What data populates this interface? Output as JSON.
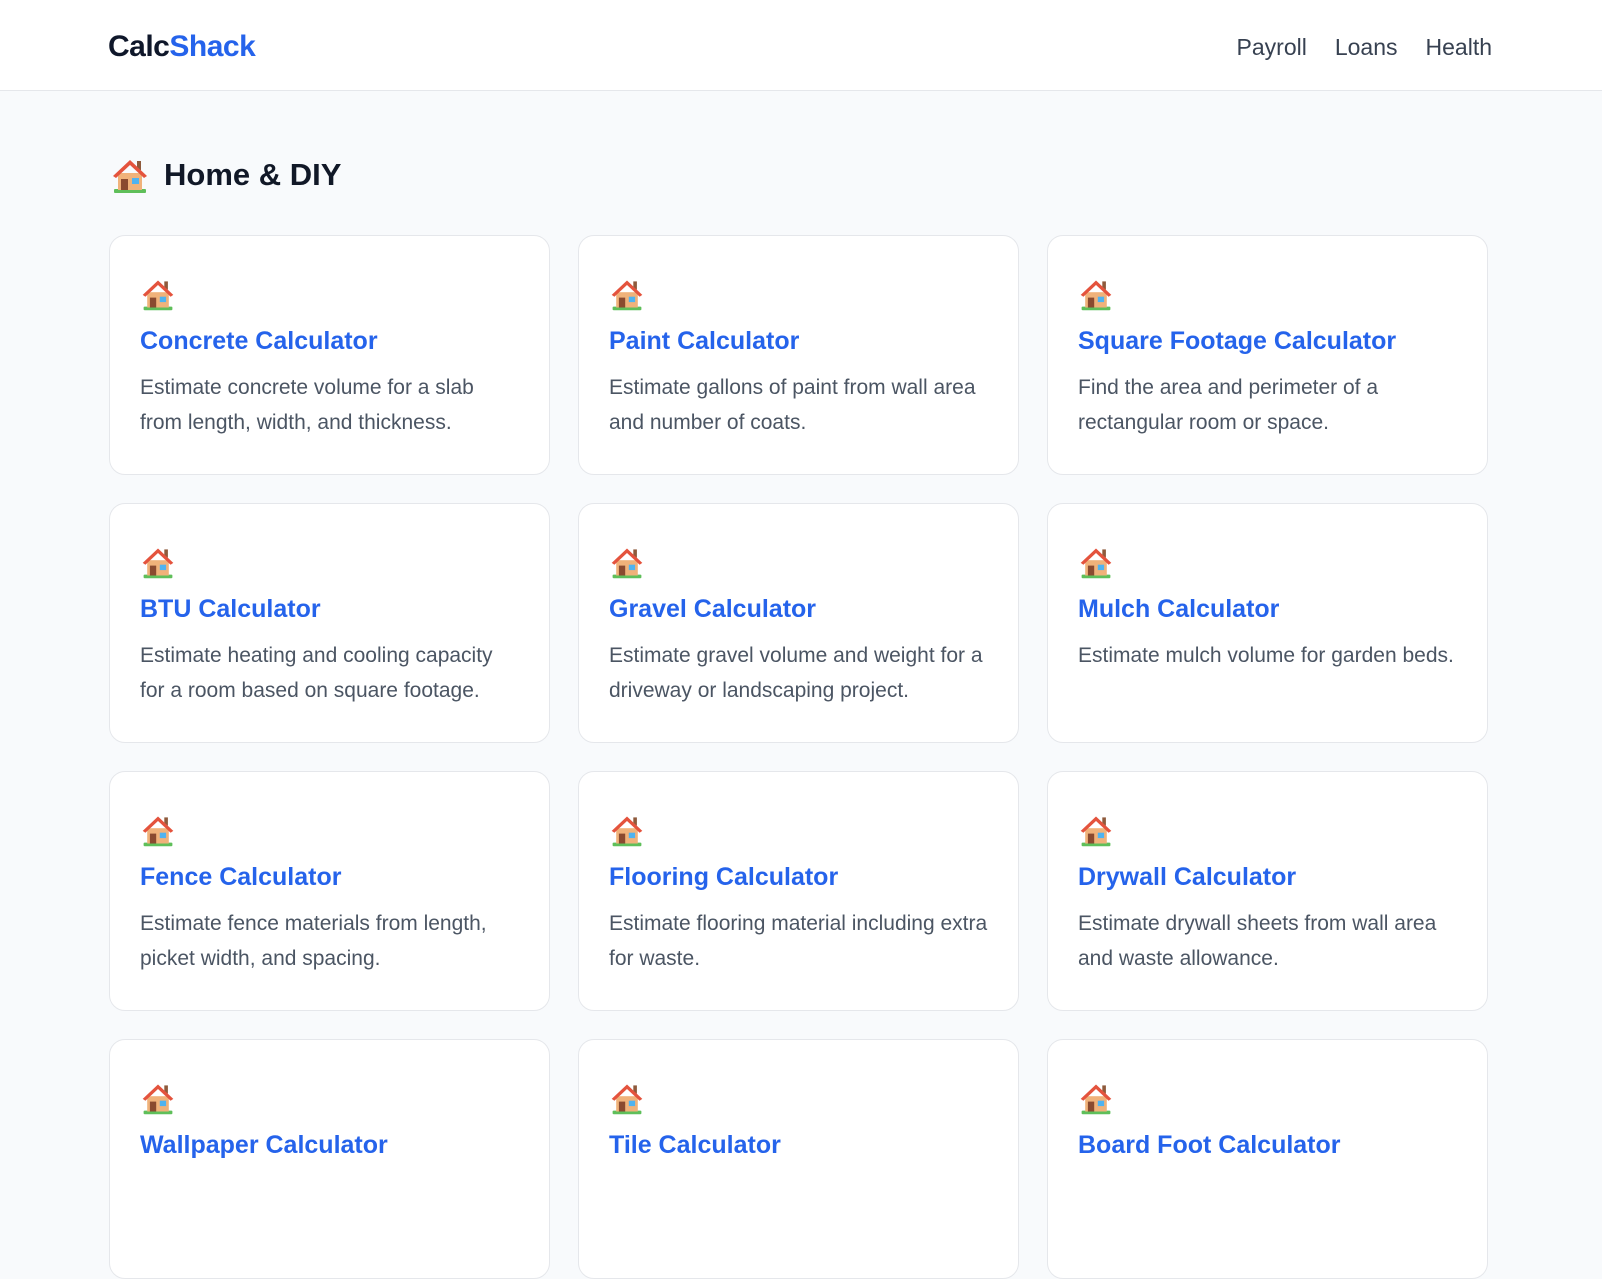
{
  "header": {
    "brand_part1": "Calc",
    "brand_part2": "Shack",
    "nav": [
      "Payroll",
      "Loans",
      "Health"
    ]
  },
  "section": {
    "icon": "house-icon",
    "title": "Home & DIY"
  },
  "cards": [
    {
      "icon": "house-icon",
      "title": "Concrete Calculator",
      "description": "Estimate concrete volume for a slab from length, width, and thickness."
    },
    {
      "icon": "house-icon",
      "title": "Paint Calculator",
      "description": "Estimate gallons of paint from wall area and number of coats."
    },
    {
      "icon": "house-icon",
      "title": "Square Footage Calculator",
      "description": "Find the area and perimeter of a rectangular room or space."
    },
    {
      "icon": "house-icon",
      "title": "BTU Calculator",
      "description": "Estimate heating and cooling capacity for a room based on square footage."
    },
    {
      "icon": "house-icon",
      "title": "Gravel Calculator",
      "description": "Estimate gravel volume and weight for a driveway or landscaping project."
    },
    {
      "icon": "house-icon",
      "title": "Mulch Calculator",
      "description": "Estimate mulch volume for garden beds."
    },
    {
      "icon": "house-icon",
      "title": "Fence Calculator",
      "description": "Estimate fence materials from length, picket width, and spacing."
    },
    {
      "icon": "house-icon",
      "title": "Flooring Calculator",
      "description": "Estimate flooring material including extra for waste."
    },
    {
      "icon": "house-icon",
      "title": "Drywall Calculator",
      "description": "Estimate drywall sheets from wall area and waste allowance."
    },
    {
      "icon": "house-icon",
      "title": "Wallpaper Calculator",
      "description": ""
    },
    {
      "icon": "house-icon",
      "title": "Tile Calculator",
      "description": ""
    },
    {
      "icon": "house-icon",
      "title": "Board Foot Calculator",
      "description": ""
    }
  ],
  "colors": {
    "accent": "#2563eb",
    "brand_dark": "#0f172a",
    "background": "#f8fafc",
    "card_border": "#e5e7eb",
    "body_text": "#4b5563"
  }
}
